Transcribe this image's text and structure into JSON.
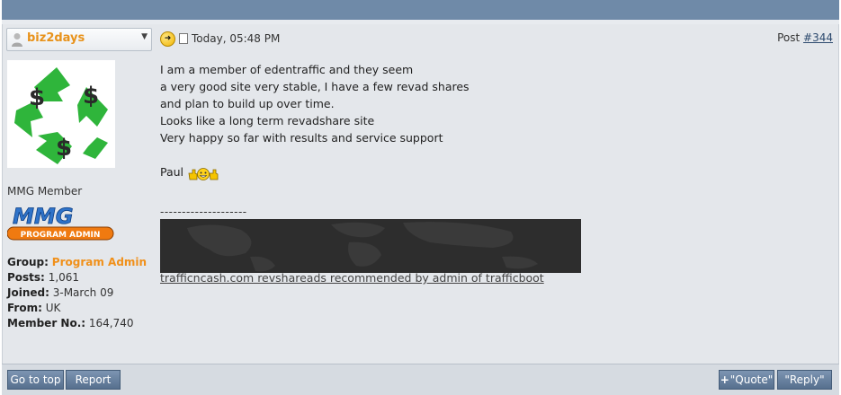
{
  "user": {
    "name": "biz2days"
  },
  "post": {
    "timestamp": "Today, 05:48 PM",
    "post_label": "Post",
    "post_number": "#344",
    "lines": [
      "I am a member of edentraffic and they seem",
      "a very good site very stable, I have a few revad shares",
      "and plan to build up over time.",
      "Looks like a long term revadshare site",
      "Very happy so far with results and service support"
    ],
    "signoff": "Paul"
  },
  "profile": {
    "member_title": "MMG Member",
    "badge_text": "PROGRAM ADMIN",
    "group_label": "Group:",
    "group_value": "Program Admin",
    "posts_label": "Posts:",
    "posts_value": "1,061",
    "joined_label": "Joined:",
    "joined_value": "3-March 09",
    "from_label": "From:",
    "from_value": "UK",
    "member_no_label": "Member No.:",
    "member_no_value": "164,740"
  },
  "signature": {
    "divider": "--------------------",
    "link_text": "trafficncash.com revshareads recommended by admin of trafficboot"
  },
  "footer": {
    "go_to_top": "Go to top",
    "report": "Report",
    "quote": "\"Quote\"",
    "reply": "\"Reply\""
  },
  "colors": {
    "topbar": "#6f8aa8",
    "accent_orange": "#f0901a",
    "button": "#6882a1"
  }
}
